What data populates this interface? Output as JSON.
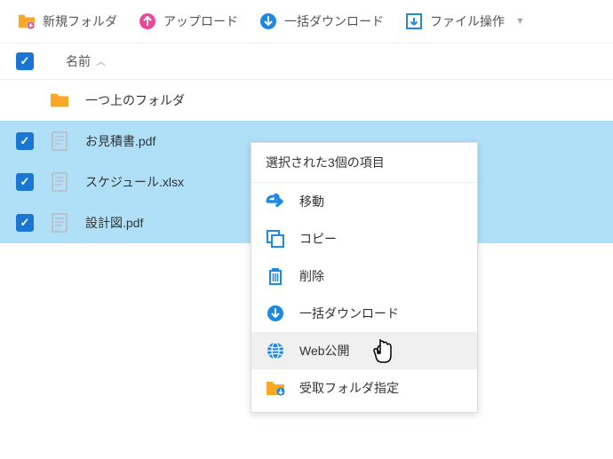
{
  "toolbar": {
    "new_folder": "新規フォルダ",
    "upload": "アップロード",
    "bulk_download": "一括ダウンロード",
    "file_ops": "ファイル操作"
  },
  "header": {
    "name_col": "名前"
  },
  "files": {
    "parent": "一つ上のフォルダ",
    "item0": "お見積書.pdf",
    "item1": "スケジュール.xlsx",
    "item2": "設計図.pdf"
  },
  "context_menu": {
    "header": "選択された3個の項目",
    "move": "移動",
    "copy": "コピー",
    "delete": "削除",
    "bulk_download": "一括ダウンロード",
    "web_publish": "Web公開",
    "receive_folder": "受取フォルダ指定"
  },
  "colors": {
    "primary_blue": "#1e88e5",
    "orange": "#f9a825",
    "pink": "#ec4899",
    "selected_bg": "#afe0f7"
  }
}
